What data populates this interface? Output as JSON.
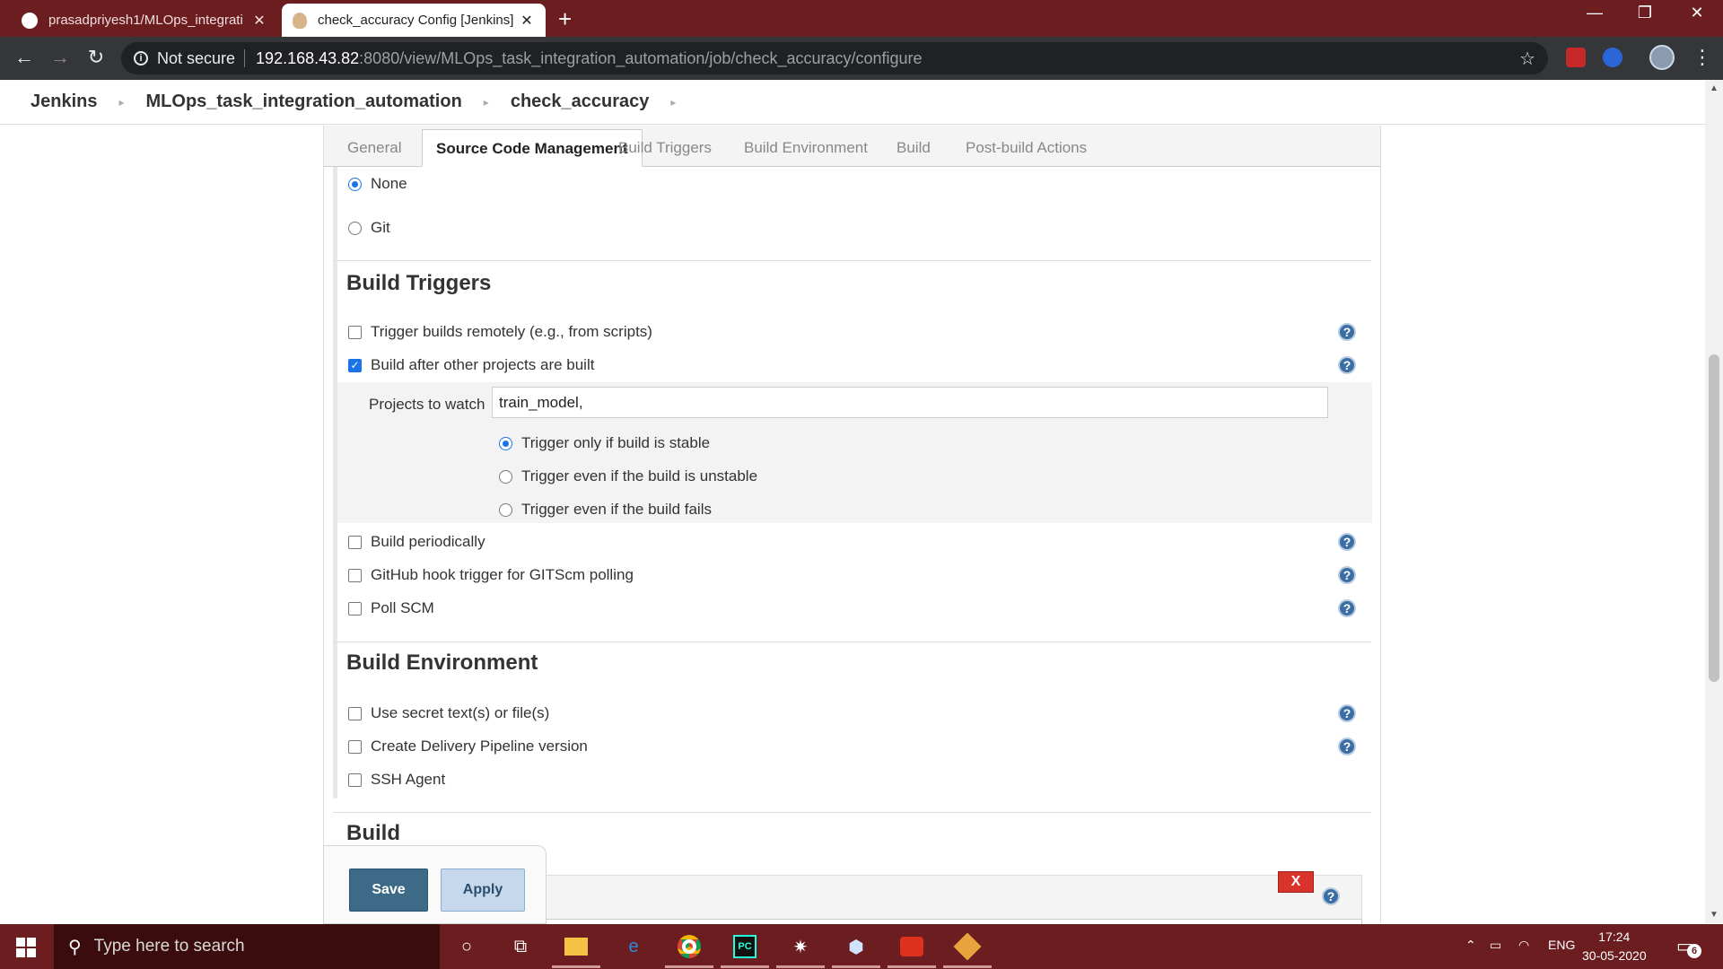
{
  "browser": {
    "tabs": [
      {
        "title": "prasadpriyesh1/MLOps_integrati",
        "active": false
      },
      {
        "title": "check_accuracy Config [Jenkins]",
        "active": true
      }
    ],
    "security_label": "Not secure",
    "url_host": "192.168.43.82",
    "url_path": ":8080/view/MLOps_task_integration_automation/job/check_accuracy/configure"
  },
  "breadcrumb": [
    "Jenkins",
    "MLOps_task_integration_automation",
    "check_accuracy"
  ],
  "config_tabs": [
    "General",
    "Source Code Management",
    "Build Triggers",
    "Build Environment",
    "Build",
    "Post-build Actions"
  ],
  "active_tab": "Source Code Management",
  "scm": {
    "none_label": "None",
    "git_label": "Git",
    "selected": "None"
  },
  "build_triggers": {
    "title": "Build Triggers",
    "remote_label": "Trigger builds remotely (e.g., from scripts)",
    "after_other_label": "Build after other projects are built",
    "projects_label": "Projects to watch",
    "projects_value": "train_model,",
    "stable_label": "Trigger only if build is stable",
    "unstable_label": "Trigger even if the build is unstable",
    "fails_label": "Trigger even if the build fails",
    "periodic_label": "Build periodically",
    "github_label": "GitHub hook trigger for GITScm polling",
    "poll_label": "Poll SCM",
    "remote_checked": false,
    "after_other_checked": true,
    "periodic_checked": false,
    "github_checked": false,
    "poll_checked": false,
    "trigger_selected": "stable"
  },
  "build_environment": {
    "title": "Build Environment",
    "secret_label": "Use secret text(s) or file(s)",
    "pipeline_label": "Create Delivery Pipeline version",
    "ssh_label": "SSH Agent",
    "secret_checked": false,
    "pipeline_checked": false,
    "ssh_checked": false
  },
  "build": {
    "title": "Build",
    "delete_label": "X"
  },
  "buttons": {
    "save": "Save",
    "apply": "Apply"
  },
  "taskbar": {
    "search_placeholder": "Type here to search",
    "language": "ENG",
    "time": "17:24",
    "date": "30-05-2020",
    "notification_count": "6"
  }
}
